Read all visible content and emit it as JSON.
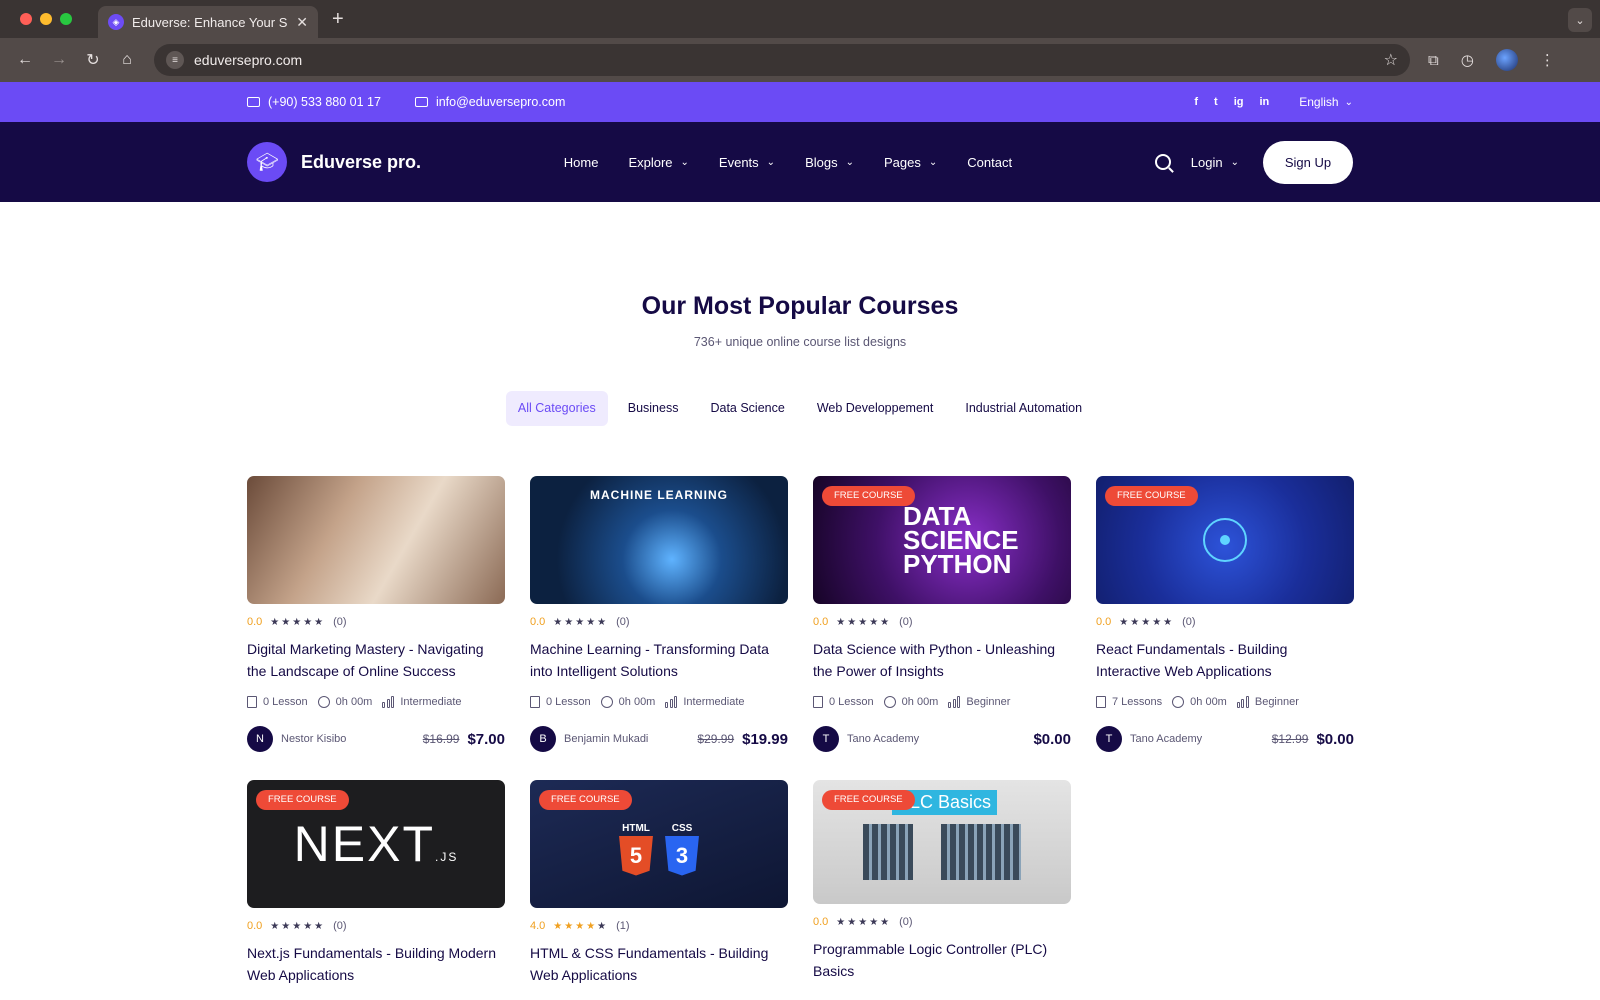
{
  "browser": {
    "tab_title": "Eduverse: Enhance Your Skills",
    "url": "eduversepro.com",
    "traffic_colors": [
      "#ff5f57",
      "#febc2e",
      "#28c840"
    ]
  },
  "topbar": {
    "phone": "(+90) 533 880 01 17",
    "email": "info@eduversepro.com",
    "social": [
      "f",
      "t",
      "ig",
      "in"
    ],
    "language": "English"
  },
  "nav": {
    "brand": "Eduverse pro.",
    "items": [
      {
        "label": "Home",
        "dropdown": false
      },
      {
        "label": "Explore",
        "dropdown": true
      },
      {
        "label": "Events",
        "dropdown": true
      },
      {
        "label": "Blogs",
        "dropdown": true
      },
      {
        "label": "Pages",
        "dropdown": true
      },
      {
        "label": "Contact",
        "dropdown": false
      }
    ],
    "login": "Login",
    "signup": "Sign Up"
  },
  "section": {
    "title": "Our Most Popular Courses",
    "subtitle": "736+ unique online course list designs"
  },
  "filters": [
    "All Categories",
    "Business",
    "Data Science",
    "Web Developpement",
    "Industrial Automation"
  ],
  "courses": [
    {
      "title": "Digital Marketing Mastery - Navigating the Landscape of Online Success",
      "rating": "0.0",
      "reviews": "(0)",
      "stars_lit": 0,
      "lessons": "0 Lesson",
      "duration": "0h 00m",
      "level": "Intermediate",
      "author_initial": "N",
      "author": "Nestor Kisibo",
      "old_price": "$16.99",
      "price": "$7.00",
      "free": false
    },
    {
      "title": "Machine Learning - Transforming Data into Intelligent Solutions",
      "rating": "0.0",
      "reviews": "(0)",
      "stars_lit": 0,
      "lessons": "0 Lesson",
      "duration": "0h 00m",
      "level": "Intermediate",
      "author_initial": "B",
      "author": "Benjamin Mukadi",
      "old_price": "$29.99",
      "price": "$19.99",
      "free": false,
      "art_text": "MACHINE  LEARNING"
    },
    {
      "title": "Data Science with Python - Unleashing the Power of Insights",
      "rating": "0.0",
      "reviews": "(0)",
      "stars_lit": 0,
      "lessons": "0 Lesson",
      "duration": "0h 00m",
      "level": "Beginner",
      "author_initial": "T",
      "author": "Tano Academy",
      "old_price": "",
      "price": "$0.00",
      "free": true,
      "art_text": "DATA SCIENCE PYTHON"
    },
    {
      "title": "React Fundamentals - Building Interactive Web Applications",
      "rating": "0.0",
      "reviews": "(0)",
      "stars_lit": 0,
      "lessons": "7 Lessons",
      "duration": "0h 00m",
      "level": "Beginner",
      "author_initial": "T",
      "author": "Tano Academy",
      "old_price": "$12.99",
      "price": "$0.00",
      "free": true
    },
    {
      "title": "Next.js Fundamentals - Building Modern Web Applications",
      "rating": "0.0",
      "reviews": "(0)",
      "stars_lit": 0,
      "free": true,
      "art_text": "NEXT",
      "art_sub": ".JS"
    },
    {
      "title": "HTML & CSS Fundamentals - Building Web Applications",
      "rating": "4.0",
      "reviews": "(1)",
      "stars_lit": 4,
      "free": true,
      "art_html": "HTML",
      "art_css": "CSS",
      "art_html_num": "5",
      "art_css_num": "3"
    },
    {
      "title": "Programmable Logic Controller (PLC) Basics",
      "rating": "0.0",
      "reviews": "(0)",
      "stars_lit": 0,
      "free": true,
      "art_text": "PLC Basics"
    }
  ],
  "free_badge": "FREE COURSE",
  "colors": {
    "brand": "#6b4bf5",
    "navy": "#150a45",
    "badge": "#ee4a37",
    "star": "#f0a020"
  }
}
